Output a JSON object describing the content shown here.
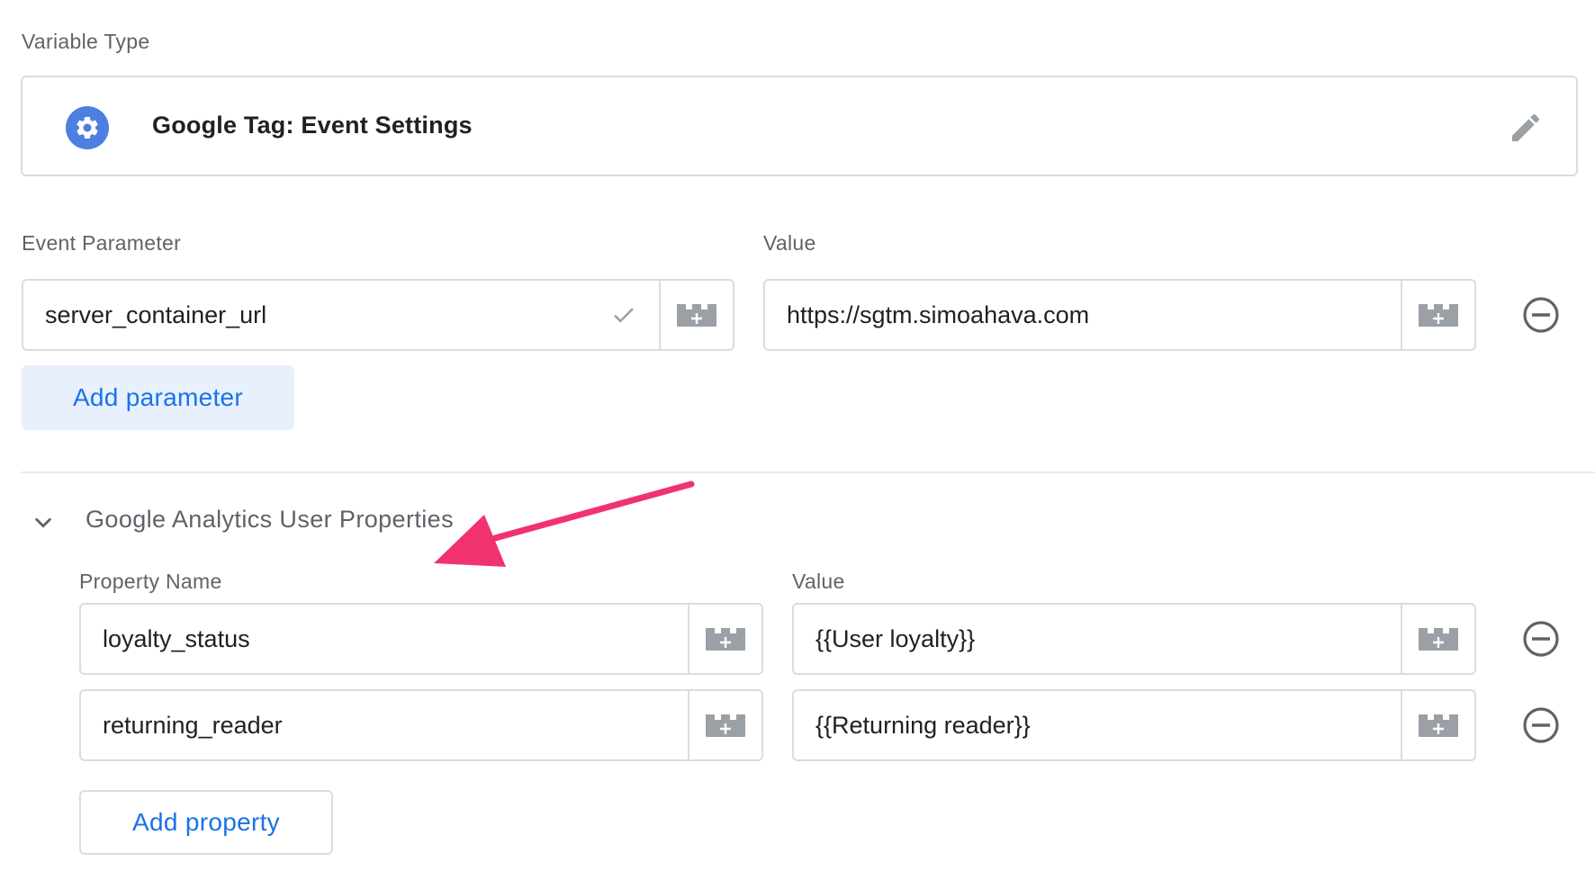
{
  "variable_type": {
    "label": "Variable Type",
    "title": "Google Tag: Event Settings"
  },
  "event_parameters": {
    "name_label": "Event Parameter",
    "value_label": "Value",
    "rows": [
      {
        "name": "server_container_url",
        "value": "https://sgtm.simoahava.com"
      }
    ],
    "add_label": "Add parameter"
  },
  "user_properties": {
    "section_title": "Google Analytics User Properties",
    "name_label": "Property Name",
    "value_label": "Value",
    "rows": [
      {
        "name": "loyalty_status",
        "value": "{{User loyalty}}"
      },
      {
        "name": "returning_reader",
        "value": "{{Returning reader}}"
      }
    ],
    "add_label": "Add property"
  },
  "colors": {
    "accent": "#1a73e8",
    "icon_bg": "#4c7fe0",
    "annotation_arrow": "#f0336f"
  },
  "icons": [
    "settings-icon",
    "edit-pencil-icon",
    "variable-picker-icon",
    "check-icon",
    "remove-row-icon",
    "chevron-down-icon"
  ]
}
